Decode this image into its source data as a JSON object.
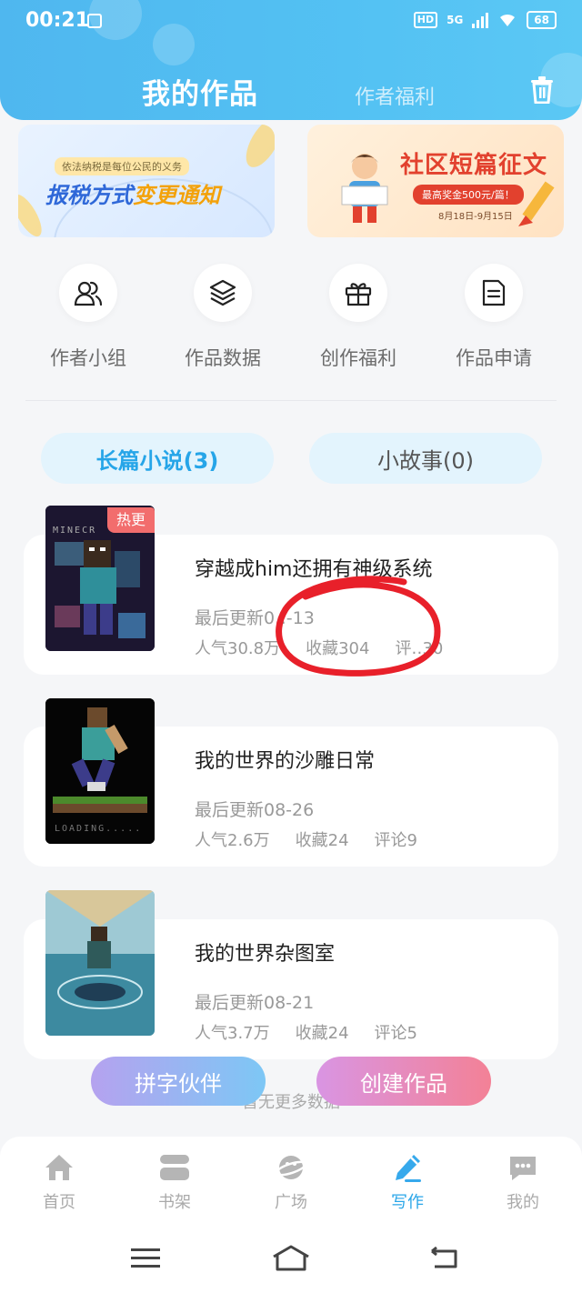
{
  "status_bar": {
    "time": "00:21",
    "network": "5G",
    "hd": "HD",
    "battery": "68"
  },
  "header": {
    "title": "我的作品",
    "secondary_tab": "作者福利"
  },
  "banners": [
    {
      "subtitle": "依法纳税是每位公民的义务",
      "title_part1": "报税方式",
      "title_part2": "变更通知"
    },
    {
      "title": "社区短篇征文",
      "prize": "最高奖金500元/篇！",
      "date": "8月18日-9月15日"
    }
  ],
  "shortcuts": [
    {
      "label": "作者小组",
      "icon": "group-icon"
    },
    {
      "label": "作品数据",
      "icon": "layers-icon"
    },
    {
      "label": "创作福利",
      "icon": "gift-icon"
    },
    {
      "label": "作品申请",
      "icon": "document-icon"
    }
  ],
  "categories": [
    {
      "label": "长篇小说(3)",
      "active": true
    },
    {
      "label": "小故事(0)",
      "active": false
    }
  ],
  "works": [
    {
      "title": "穿越成him还拥有神级系统",
      "updated": "最后更新0‥-13",
      "popularity": "人气30.8万",
      "favorites": "收藏304",
      "comments": "评‥30",
      "badge": "热更"
    },
    {
      "title": "我的世界的沙雕日常",
      "updated": "最后更新08-26",
      "popularity": "人气2.6万",
      "favorites": "收藏24",
      "comments": "评论9"
    },
    {
      "title": "我的世界杂图室",
      "updated": "最后更新08-21",
      "popularity": "人气3.7万",
      "favorites": "收藏24",
      "comments": "评论5"
    }
  ],
  "no_more": "暂无更多数据",
  "buttons": {
    "partner": "拼字伙伴",
    "create": "创建作品"
  },
  "bottom_nav": [
    {
      "label": "首页",
      "icon": "home-icon"
    },
    {
      "label": "书架",
      "icon": "bookshelf-icon"
    },
    {
      "label": "广场",
      "icon": "planet-icon"
    },
    {
      "label": "写作",
      "icon": "pen-icon",
      "active": true
    },
    {
      "label": "我的",
      "icon": "chat-icon"
    }
  ],
  "colors": {
    "accent": "#2aa6e8",
    "header": "#53c1f3",
    "hot": "#f26d6d",
    "annotation": "#e8202a"
  }
}
